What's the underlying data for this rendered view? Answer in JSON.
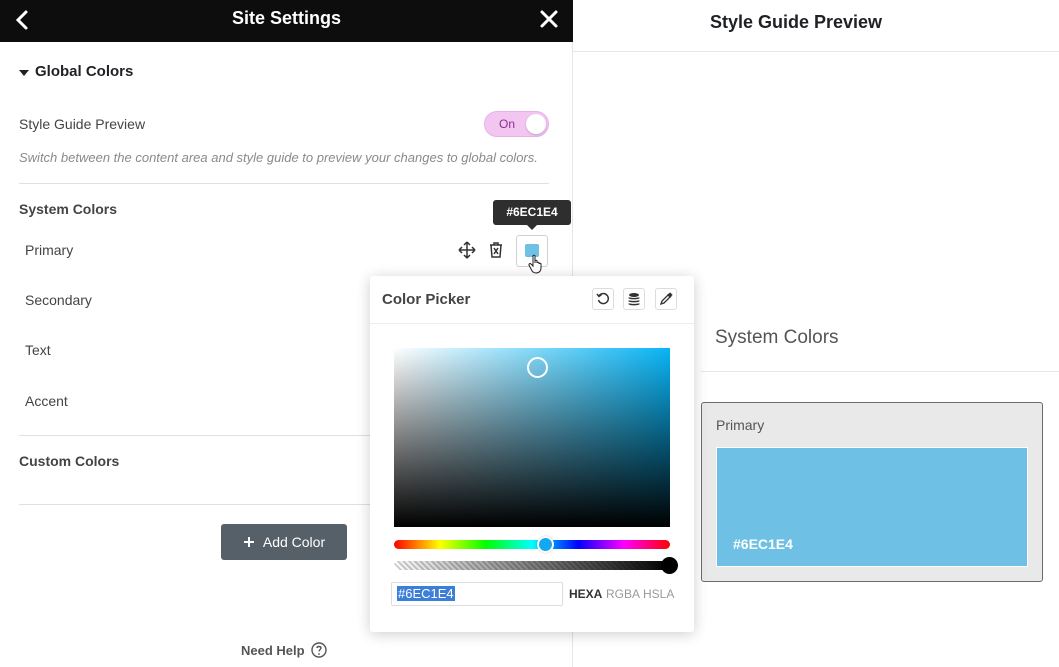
{
  "header": {
    "title": "Site Settings"
  },
  "global_colors": {
    "section_title": "Global Colors",
    "style_guide_label": "Style Guide Preview",
    "toggle_text": "On",
    "hint": "Switch between the content area and style guide to preview your changes to global colors."
  },
  "system_colors": {
    "title": "System Colors",
    "items": [
      {
        "label": "Primary"
      },
      {
        "label": "Secondary"
      },
      {
        "label": "Text"
      },
      {
        "label": "Accent"
      }
    ]
  },
  "custom_colors": {
    "title": "Custom Colors"
  },
  "tooltip": {
    "text": "#6EC1E4"
  },
  "add_color": {
    "label": "Add Color"
  },
  "footer": {
    "need_help": "Need Help"
  },
  "picker": {
    "title": "Color Picker",
    "hex_value": "#6EC1E4",
    "formats": [
      "HEXA",
      "RGBA",
      "HSLA"
    ]
  },
  "preview": {
    "title": "Style Guide Preview",
    "section_title": "System Colors",
    "card_label": "Primary",
    "card_hex": "#6EC1E4"
  },
  "colors": {
    "primary": "#6ec1e4",
    "toggle_bg": "#f3c6f2",
    "header_bg": "#0d0d0d"
  }
}
